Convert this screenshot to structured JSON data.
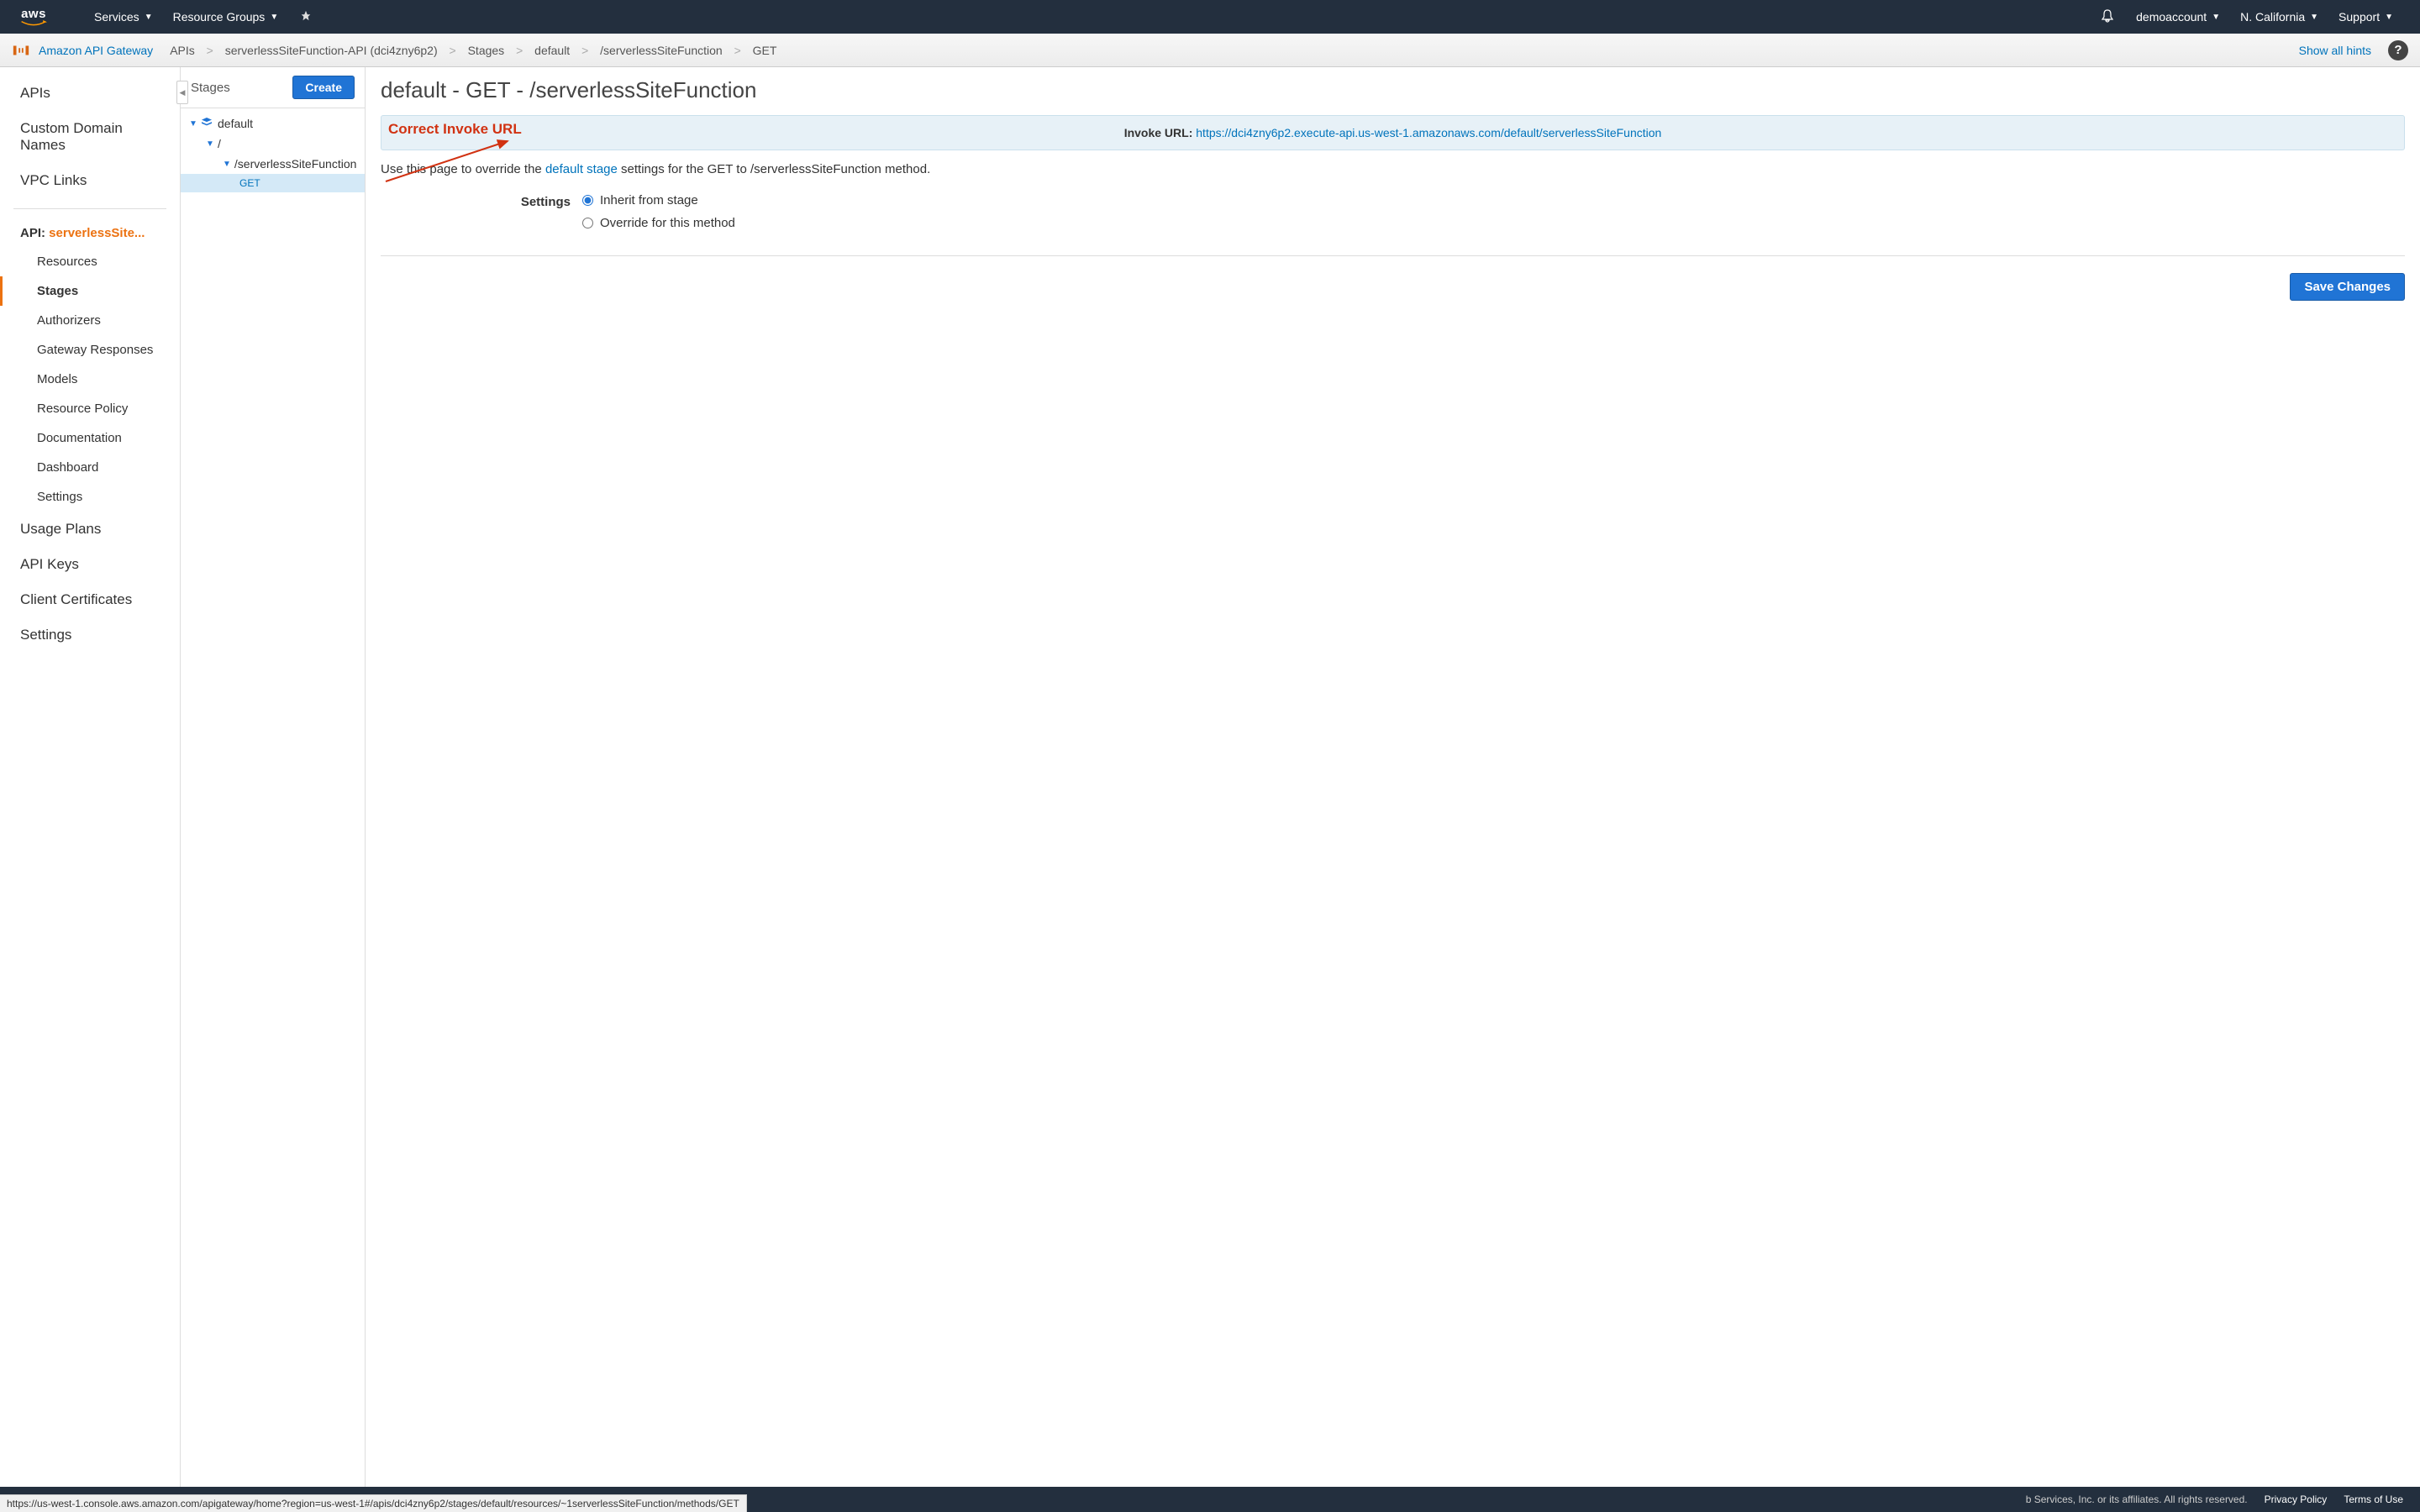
{
  "topnav": {
    "services": "Services",
    "resource_groups": "Resource Groups",
    "account": "demoaccount",
    "region": "N. California",
    "support": "Support"
  },
  "subheader": {
    "service_name": "Amazon API Gateway",
    "crumbs": [
      "APIs",
      "serverlessSiteFunction-API (dci4zny6p2)",
      "Stages",
      "default",
      "/serverlessSiteFunction",
      "GET"
    ],
    "show_hints": "Show all hints"
  },
  "sidebar": {
    "top_items": [
      "APIs",
      "Custom Domain Names",
      "VPC Links"
    ],
    "api_prefix": "API: ",
    "api_name": "serverlessSite...",
    "api_items": [
      "Resources",
      "Stages",
      "Authorizers",
      "Gateway Responses",
      "Models",
      "Resource Policy",
      "Documentation",
      "Dashboard",
      "Settings"
    ],
    "active_api_item": "Stages",
    "bottom_items": [
      "Usage Plans",
      "API Keys",
      "Client Certificates",
      "Settings"
    ]
  },
  "stages": {
    "title": "Stages",
    "create": "Create",
    "tree": {
      "stage": "default",
      "root": "/",
      "resource": "/serverlessSiteFunction",
      "method": "GET"
    }
  },
  "content": {
    "heading": "default - GET - /serverlessSiteFunction",
    "annotation": "Correct Invoke URL",
    "invoke_label": "Invoke URL: ",
    "invoke_url": "https://dci4zny6p2.execute-api.us-west-1.amazonaws.com/default/serverlessSiteFunction",
    "desc_pre": "Use this page to override the ",
    "desc_link": "default stage",
    "desc_post": " settings for the GET to /serverlessSiteFunction method.",
    "settings_label": "Settings",
    "opt_inherit": "Inherit from stage",
    "opt_override": "Override for this method",
    "save": "Save Changes"
  },
  "footer": {
    "copyright": "b Services, Inc. or its affiliates. All rights reserved.",
    "privacy": "Privacy Policy",
    "terms": "Terms of Use"
  },
  "status_url": "https://us-west-1.console.aws.amazon.com/apigateway/home?region=us-west-1#/apis/dci4zny6p2/stages/default/resources/~1serverlessSiteFunction/methods/GET"
}
